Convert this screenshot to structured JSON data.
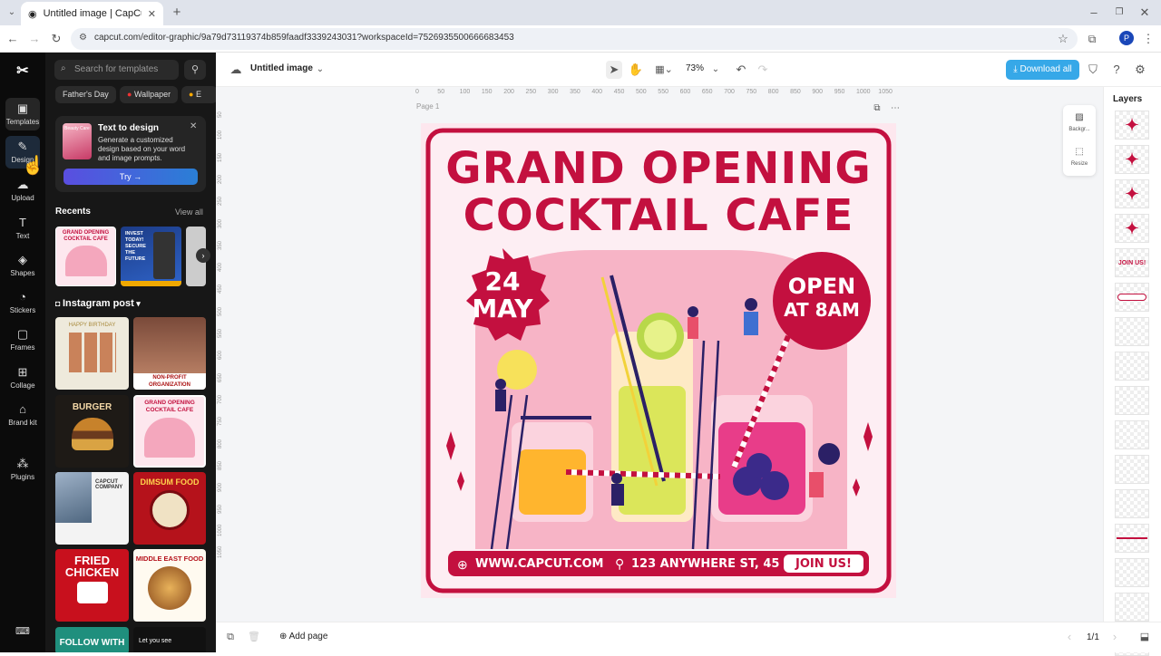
{
  "browser": {
    "tab_title": "Untitled image | CapCut",
    "url": "capcut.com/editor-graphic/9a79d73119374b859faadf3339243031?workspaceId=7526935500666683453",
    "profile_initial": "P"
  },
  "rail": {
    "items": [
      {
        "label": "Templates"
      },
      {
        "label": "Design"
      },
      {
        "label": "Upload"
      },
      {
        "label": "Text"
      },
      {
        "label": "Shapes"
      },
      {
        "label": "Stickers"
      },
      {
        "label": "Frames"
      },
      {
        "label": "Collage"
      },
      {
        "label": "Brand kit"
      },
      {
        "label": "Plugins"
      }
    ]
  },
  "panel": {
    "search_placeholder": "Search for templates",
    "chips": [
      "Father's Day",
      "Wallpaper",
      "E"
    ],
    "text_to_design": {
      "title": "Text to design",
      "desc": "Generate a customized design based on your word and image prompts.",
      "thumb_label": "Beauty Care",
      "button": "Try →"
    },
    "recents_title": "Recents",
    "view_all": "View all",
    "section_title": "Instagram post",
    "recents": [
      {
        "title": "GRAND OPENING COCKTAIL CAFE"
      },
      {
        "title": "INVEST TODAY! SECURE THE FUTURE"
      }
    ],
    "templates": [
      {
        "title": "HAPPY BIRTHDAY"
      },
      {
        "title": "NON-PROFIT ORGANIZATION"
      },
      {
        "title": "BURGER"
      },
      {
        "title": "GRAND OPENING COCKTAIL CAFE"
      },
      {
        "title": "CAPCUT COMPANY"
      },
      {
        "title": "DIMSUM FOOD"
      },
      {
        "title": "FRIED CHICKEN"
      },
      {
        "title": "MIDDLE EAST FOOD"
      },
      {
        "title": "FOLLOW WITH"
      },
      {
        "title": "Let you see"
      }
    ]
  },
  "toolbar": {
    "doc_title": "Untitled image",
    "zoom": "73%",
    "download": "Download all"
  },
  "canvas": {
    "page_label": "Page 1",
    "ruler_ticks": [
      "0",
      "50",
      "100",
      "150",
      "200",
      "250",
      "300",
      "350",
      "400",
      "450",
      "500",
      "550",
      "600",
      "650",
      "700",
      "750",
      "800",
      "850",
      "900",
      "950",
      "1000",
      "1050"
    ],
    "side_ticks": [
      "50",
      "100",
      "150",
      "200",
      "250",
      "300",
      "350",
      "400",
      "450",
      "500",
      "550",
      "600",
      "650",
      "700",
      "750",
      "800",
      "850",
      "900",
      "950",
      "1000",
      "1050"
    ],
    "float_actions": [
      "Backgr...",
      "Resize"
    ]
  },
  "poster": {
    "line1": "GRAND OPENING",
    "line2": "COCKTAIL CAFE",
    "date_day": "24",
    "date_month": "MAY",
    "open1": "OPEN",
    "open2": "AT 8AM",
    "website": "WWW.CAPCUT.COM",
    "address": "123 ANYWHERE ST, 45",
    "cta": "JOIN US!"
  },
  "layers": {
    "title": "Layers",
    "items": [
      "sparkle",
      "sparkle",
      "sparkle",
      "sparkle",
      "JOIN US!",
      "pill",
      "",
      "",
      "",
      "",
      "",
      "",
      "line",
      "",
      "",
      ""
    ]
  },
  "bottom": {
    "add_page": "Add page",
    "pages": "1/1"
  },
  "colors": {
    "brand": "#c3103f",
    "accent": "#36a8e8",
    "poster_bg": "#fde7ee"
  }
}
